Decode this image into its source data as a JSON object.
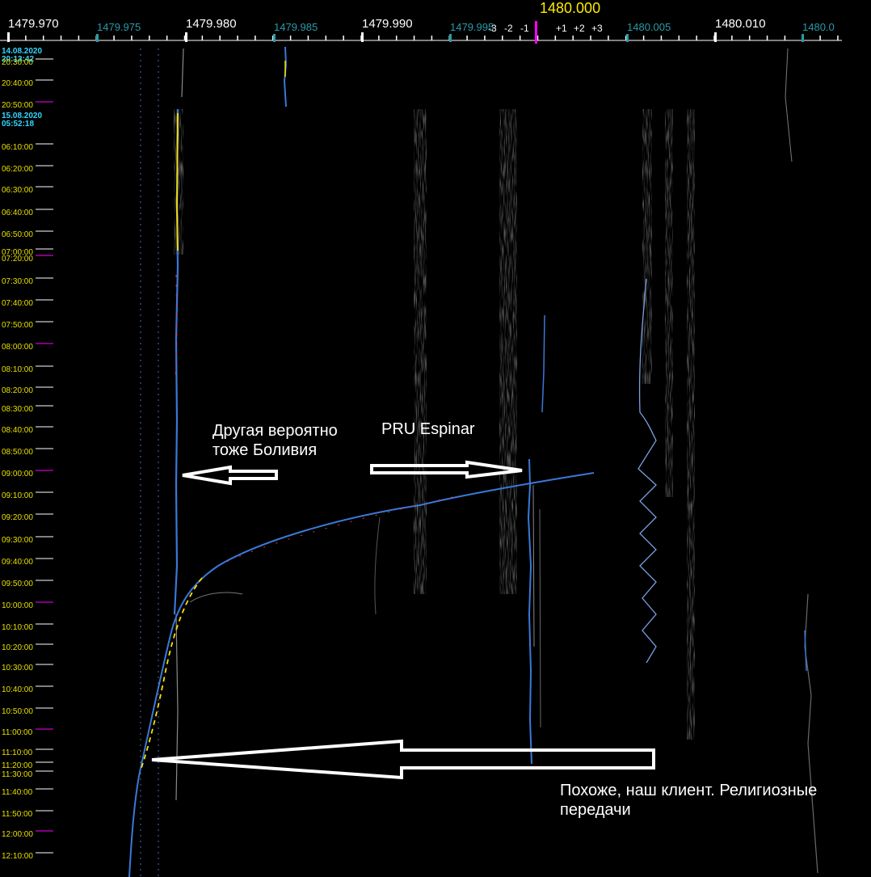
{
  "frequency_axis": {
    "major_labels": [
      "1479.970",
      "1479.980",
      "1479.990",
      "1480.010"
    ],
    "minor_labels": [
      "1479.975",
      "1479.985",
      "1479.995",
      "1480.005",
      "1480.0"
    ],
    "center_label": "1480.000",
    "offset_labels": [
      "-3",
      "-2",
      "-1",
      "+1",
      "+2",
      "+3"
    ]
  },
  "time_axis": {
    "date_labels": [
      "14.08.2020",
      "20:13:42",
      "15.08.2020",
      "05:52:18"
    ],
    "labels": [
      "20:30:00",
      "20:40:00",
      "20:50:00",
      "06:10:00",
      "06:20:00",
      "06:30:00",
      "06:40:00",
      "06:50:00",
      "07:00:00",
      "07:20:00",
      "07:30:00",
      "07:40:00",
      "07:50:00",
      "08:00:00",
      "08:10:00",
      "08:20:00",
      "08:30:00",
      "08:40:00",
      "08:50:00",
      "09:00:00",
      "09:10:00",
      "09:20:00",
      "09:30:00",
      "09:40:00",
      "09:50:00",
      "10:00:00",
      "10:10:00",
      "10:20:00",
      "10:30:00",
      "10:40:00",
      "10:50:00",
      "11:00:00",
      "11:10:00",
      "11:20:00",
      "11:30:00",
      "11:40:00",
      "11:50:00",
      "12:00:00",
      "12:10:00"
    ]
  },
  "annotations": {
    "bolivia": [
      "Другая вероятно",
      "тоже Боливия"
    ],
    "espinar": "PRU Espinar",
    "client": [
      "Похоже, наш клиент. Религиозные",
      "передачи"
    ]
  },
  "colors": {
    "background": "#000000",
    "center_marker": "#ff00ff",
    "trace_blue": "#3b78d8",
    "trace_yellow": "#ffe000",
    "trace_red": "#ff2020",
    "arrow": "#ffffff"
  }
}
